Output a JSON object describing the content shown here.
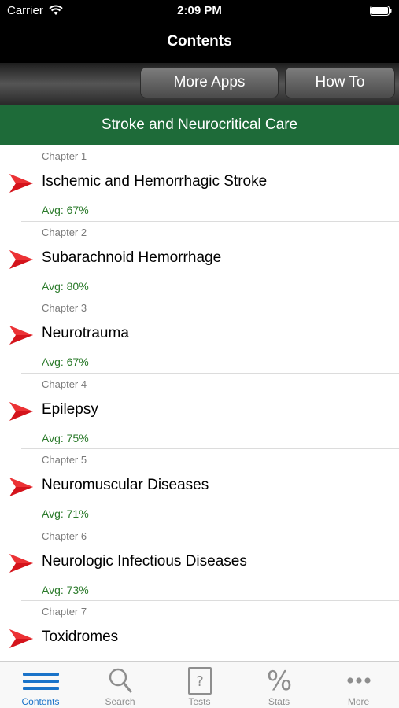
{
  "status_bar": {
    "carrier": "Carrier",
    "time": "2:09 PM"
  },
  "nav": {
    "title": "Contents"
  },
  "toolbar": {
    "more_apps_label": "More Apps",
    "how_to_label": "How To"
  },
  "section": {
    "title": "Stroke and Neurocritical Care"
  },
  "chapters": [
    {
      "number": "Chapter 1",
      "title": "Ischemic and Hemorrhagic Stroke",
      "avg": "Avg: 67%"
    },
    {
      "number": "Chapter 2",
      "title": "Subarachnoid Hemorrhage",
      "avg": "Avg: 80%"
    },
    {
      "number": "Chapter 3",
      "title": "Neurotrauma",
      "avg": "Avg: 67%"
    },
    {
      "number": "Chapter 4",
      "title": "Epilepsy",
      "avg": "Avg: 75%"
    },
    {
      "number": "Chapter 5",
      "title": "Neuromuscular Diseases",
      "avg": "Avg: 71%"
    },
    {
      "number": "Chapter 6",
      "title": "Neurologic Infectious Diseases",
      "avg": "Avg: 73%"
    },
    {
      "number": "Chapter 7",
      "title": "Toxidromes",
      "avg": ""
    }
  ],
  "tabs": [
    {
      "label": "Contents",
      "icon": "list-icon",
      "active": true
    },
    {
      "label": "Search",
      "icon": "search-icon",
      "active": false
    },
    {
      "label": "Tests",
      "icon": "question-page-icon",
      "active": false
    },
    {
      "label": "Stats",
      "icon": "percent-icon",
      "active": false
    },
    {
      "label": "More",
      "icon": "more-dots-icon",
      "active": false
    }
  ],
  "colors": {
    "header_green": "#1e6b39",
    "avg_green": "#2a7a2a",
    "arrow_red": "#d4141c",
    "tab_active": "#1a73c9",
    "tab_inactive": "#8e8e8e"
  }
}
